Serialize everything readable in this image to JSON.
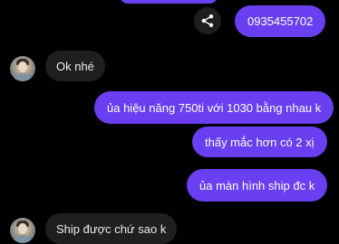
{
  "messages": {
    "m1": "0935455702",
    "m2": "Ok nhé",
    "m3": "ủa hiệu năng 750ti với 1030 bằng nhau k",
    "m4": "thấy mắc hơn có 2 xị",
    "m5": "ủa màn hình ship đc k",
    "m6": "Ship được chứ sao k"
  },
  "icons": {
    "share": "share-icon",
    "avatar": "contact-avatar"
  },
  "colors": {
    "background": "#000000",
    "outgoing_bubble": "#6a3ff1",
    "incoming_bubble": "#1f1f1f",
    "text_light": "#ffffff"
  }
}
